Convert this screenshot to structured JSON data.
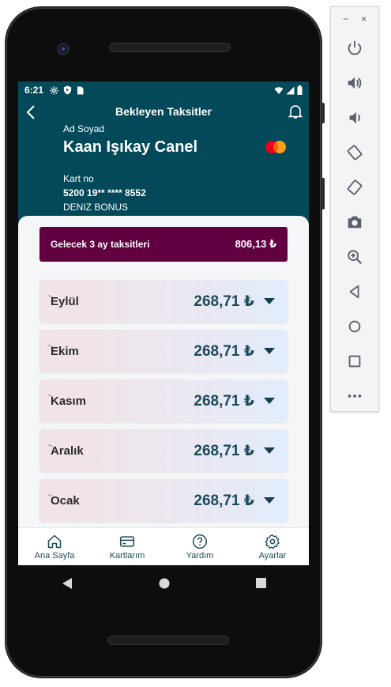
{
  "status_bar": {
    "time": "6:21"
  },
  "header": {
    "title": "Bekleyen Taksitler",
    "name_label": "Ad Soyad",
    "name": "Kaan Işıkay Canel",
    "card_label": "Kart no",
    "card_number": "5200 19** **** 8552",
    "card_name": "DENIZ BONUS"
  },
  "summary": {
    "label": "Gelecek 3 ay taksitleri",
    "amount": "806,13 ₺"
  },
  "months": [
    {
      "name": "Eylül",
      "amount": "268,71 ₺"
    },
    {
      "name": "Ekim",
      "amount": "268,71 ₺"
    },
    {
      "name": "Kasım",
      "amount": "268,71 ₺"
    },
    {
      "name": "Aralık",
      "amount": "268,71 ₺"
    },
    {
      "name": "Ocak",
      "amount": "268,71 ₺"
    }
  ],
  "bottom_nav": [
    {
      "label": "Ana Sayfa",
      "icon": "home-icon"
    },
    {
      "label": "Kartlarım",
      "icon": "card-icon"
    },
    {
      "label": "Yardım",
      "icon": "help-icon"
    },
    {
      "label": "Ayarlar",
      "icon": "settings-icon"
    }
  ],
  "emulator_tools": [
    "power-icon",
    "volume-up-icon",
    "volume-down-icon",
    "rotate-left-icon",
    "rotate-right-icon",
    "camera-icon",
    "zoom-icon",
    "back-icon",
    "home-icon",
    "overview-icon",
    "more-icon"
  ],
  "colors": {
    "header_bg": "#03495a",
    "summary_bg": "#600040",
    "amount_text": "#1c4a5a",
    "mastercard_red": "#eb001b",
    "mastercard_orange": "#f79e1b"
  }
}
